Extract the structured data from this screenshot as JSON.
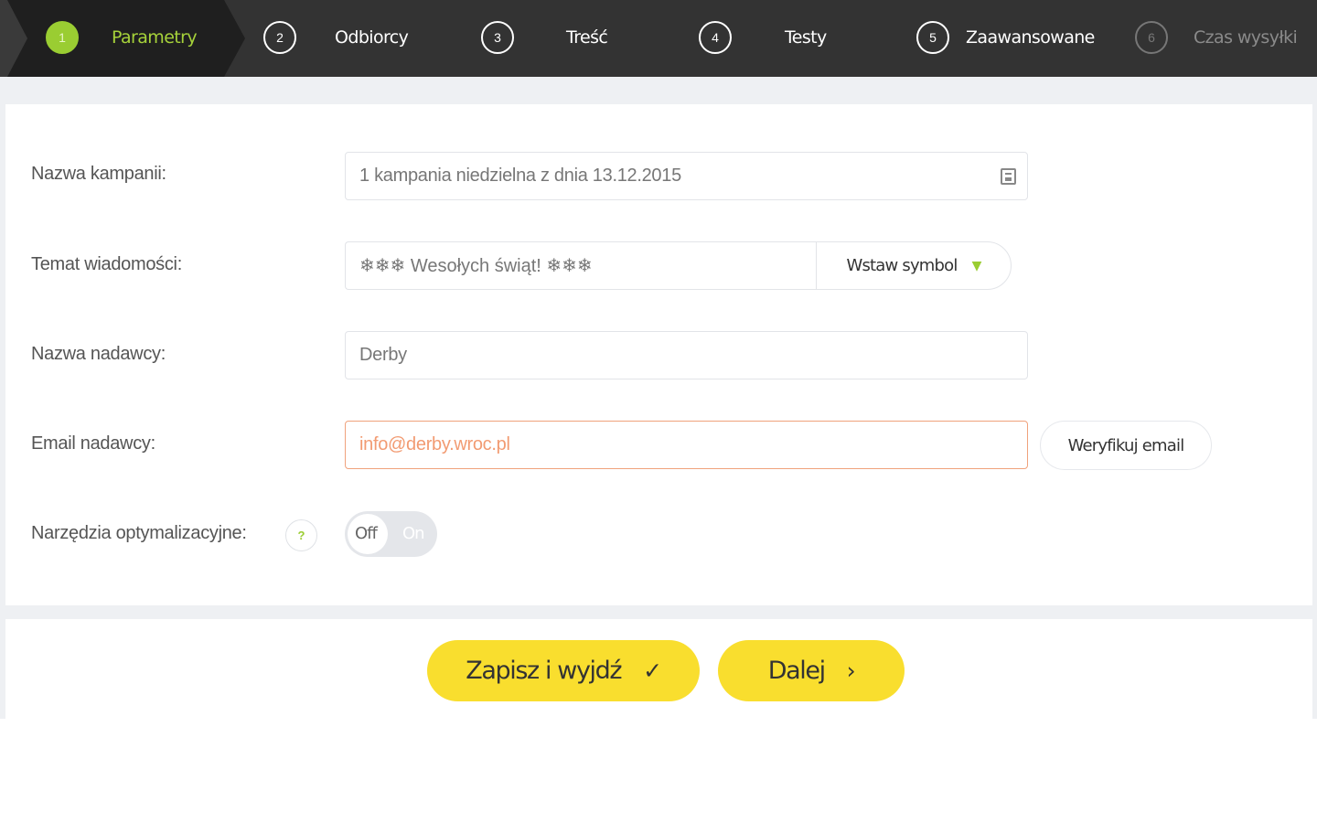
{
  "stepper": {
    "steps": [
      {
        "number": "1",
        "label": "Parametry",
        "state": "active"
      },
      {
        "number": "2",
        "label": "Odbiorcy",
        "state": "default"
      },
      {
        "number": "3",
        "label": "Treść",
        "state": "default"
      },
      {
        "number": "4",
        "label": "Testy",
        "state": "default"
      },
      {
        "number": "5",
        "label": "Zaawansowane",
        "state": "default"
      },
      {
        "number": "6",
        "label": "Czas wysyłki",
        "state": "disabled"
      }
    ]
  },
  "form": {
    "campaign_name": {
      "label": "Nazwa kampanii:",
      "value": "1 kampania niedzielna z dnia 13.12.2015"
    },
    "subject": {
      "label": "Temat wiadomości:",
      "value": "❄❄❄ Wesołych świąt! ❄❄❄",
      "symbol_button": "Wstaw symbol"
    },
    "sender_name": {
      "label": "Nazwa nadawcy:",
      "value": "Derby"
    },
    "sender_email": {
      "label": "Email nadawcy:",
      "value": "info@derby.wroc.pl",
      "verify_button": "Weryfikuj email"
    },
    "optimization": {
      "label": "Narzędzia optymalizacyjne:",
      "help": "?",
      "toggle_off": "Off",
      "toggle_on": "On"
    }
  },
  "actions": {
    "save_exit": "Zapisz i wyjdź",
    "next": "Dalej"
  },
  "colors": {
    "accent_green": "#9acd32",
    "button_yellow": "#f9de2e",
    "error_orange": "#f29b72",
    "topbar": "#333333"
  }
}
